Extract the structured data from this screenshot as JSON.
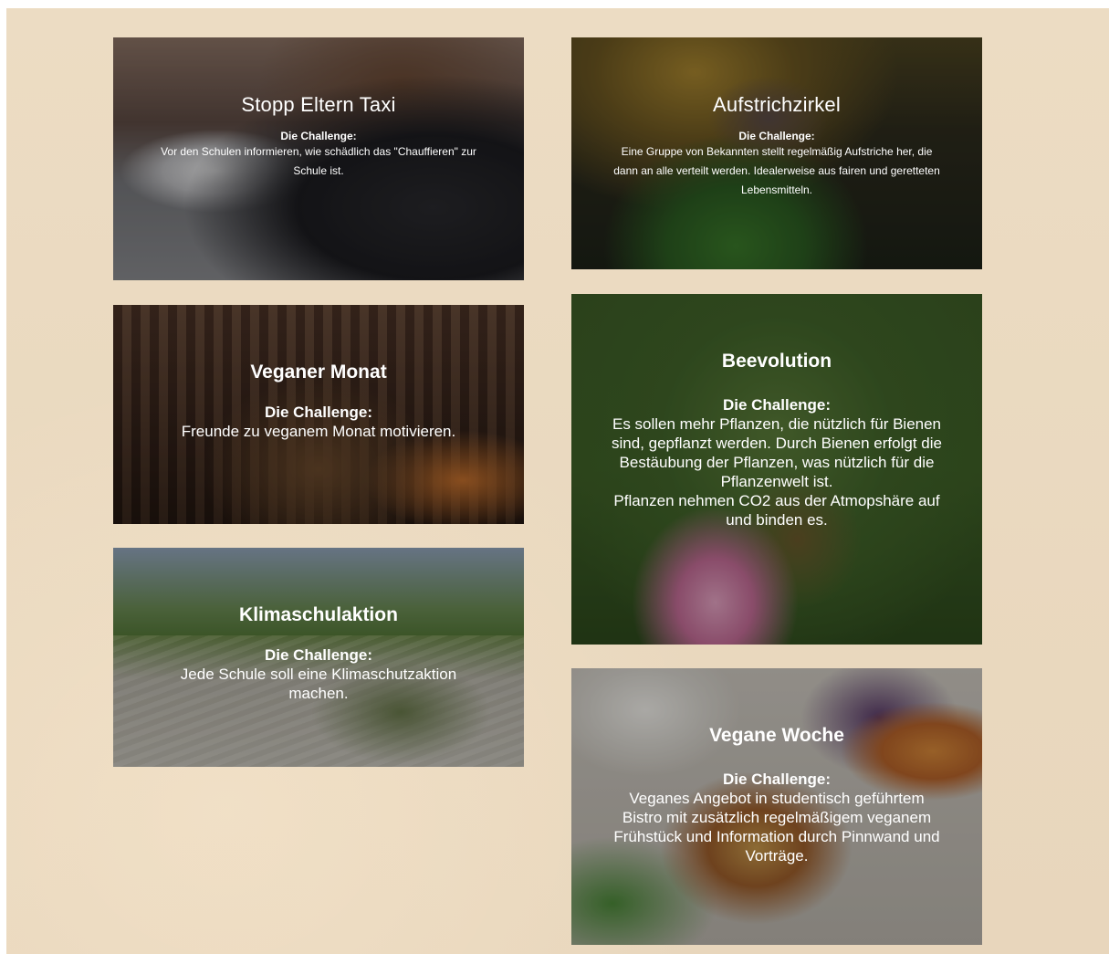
{
  "cards": [
    {
      "title": "Stopp Eltern Taxi",
      "label": "Die Challenge:",
      "text": "Vor den Schulen informieren, wie schädlich das \"Chauffieren\" zur Schule ist."
    },
    {
      "title": "Aufstrichzirkel",
      "label": "Die Challenge:",
      "text": "Eine Gruppe von Bekannten stellt regelmäßig Aufstriche her, die dann an alle verteilt werden. Idealerweise aus fairen und geretteten Lebensmitteln."
    },
    {
      "title": "Veganer Monat",
      "label": "Die Challenge:",
      "text": "Freunde zu veganem Monat motivieren."
    },
    {
      "title": "Beevolution",
      "label": "Die Challenge:",
      "text": "Es sollen mehr Pflanzen, die nützlich für Bienen sind, gepflanzt werden. Durch Bienen erfolgt die Bestäubung der Pflanzen, was nützlich für die Pflanzenwelt ist.",
      "text2": "Pflanzen nehmen CO2 aus der Atmopshäre auf und binden es."
    },
    {
      "title": "Klimaschulaktion",
      "label": "Die Challenge:",
      "text": "Jede Schule soll eine Klimaschutzaktion machen."
    },
    {
      "title": "Vegane Woche",
      "label": "Die Challenge:",
      "text": "Veganes Angebot in studentisch geführtem Bistro mit zusätzlich regelmäßigem veganem Frühstück und Information durch Pinnwand und Vorträge."
    }
  ]
}
